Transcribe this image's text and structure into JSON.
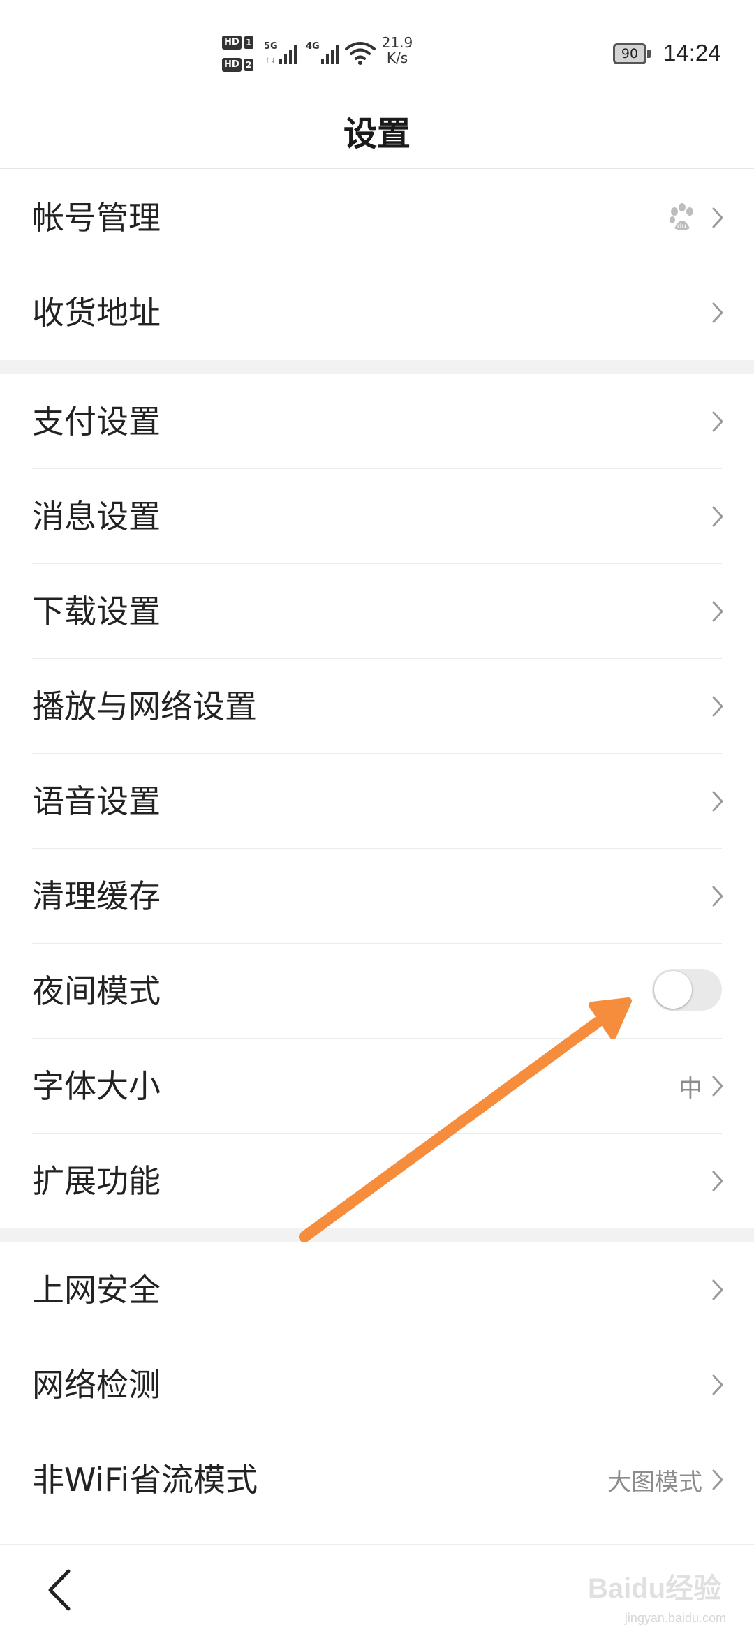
{
  "status_bar": {
    "sim1_label": "HD",
    "sim1_num": "1",
    "sim2_label": "HD",
    "sim2_num": "2",
    "signal1_type": "5G",
    "signal2_type": "4G",
    "net_speed_value": "21.9",
    "net_speed_unit": "K/s",
    "battery": "90",
    "time": "14:24"
  },
  "header": {
    "title": "设置"
  },
  "sections": [
    {
      "items": [
        {
          "label": "帐号管理",
          "icon": "baidu-paw-icon"
        },
        {
          "label": "收货地址"
        }
      ]
    },
    {
      "items": [
        {
          "label": "支付设置"
        },
        {
          "label": "消息设置"
        },
        {
          "label": "下载设置"
        },
        {
          "label": "播放与网络设置"
        },
        {
          "label": "语音设置"
        },
        {
          "label": "清理缓存"
        },
        {
          "label": "夜间模式",
          "toggle": false
        },
        {
          "label": "字体大小",
          "value": "中"
        },
        {
          "label": "扩展功能"
        }
      ]
    },
    {
      "items": [
        {
          "label": "上网安全"
        },
        {
          "label": "网络检测"
        },
        {
          "label": "非WiFi省流模式",
          "value": "大图模式"
        }
      ]
    }
  ],
  "annotation": {
    "color": "#f58d3d"
  },
  "watermark": {
    "logo_text": "Baidu经验",
    "url": "jingyan.baidu.com"
  },
  "colors": {
    "background": "#ffffff",
    "section_gap": "#f2f2f2",
    "chevron": "#9a9a9a",
    "toggle_off": "#e9e9e9"
  }
}
